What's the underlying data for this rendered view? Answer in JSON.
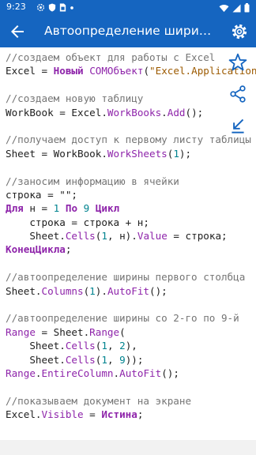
{
  "status_bar": {
    "time": "9:23",
    "left_icons": [
      "gear-icon",
      "shield-icon",
      "sim-icon",
      "dot-icon"
    ],
    "right_icons": [
      "wifi-icon",
      "signal-icon",
      "battery-icon"
    ]
  },
  "app_bar": {
    "title": "Автоопределение ширины ст...",
    "back_icon": "arrow-back-icon",
    "settings_icon": "settings-icon",
    "background": "#1565c0"
  },
  "side_actions": [
    "star-outline-icon",
    "share-icon",
    "download-icon"
  ],
  "code": {
    "colors": {
      "comment": "#757575",
      "keyword": "#8e24aa",
      "number": "#00838f",
      "string": "#9c5a00",
      "text": "#202020"
    },
    "lines": [
      [
        {
          "t": "c",
          "v": "//создаем объект для работы с Excel"
        }
      ],
      [
        {
          "t": "t",
          "v": "Excel = "
        },
        {
          "t": "k",
          "v": "Новый"
        },
        {
          "t": "t",
          "v": " "
        },
        {
          "t": "f",
          "v": "COMОбъект"
        },
        {
          "t": "t",
          "v": "("
        },
        {
          "t": "s",
          "v": "\"Excel.Application\""
        },
        {
          "t": "t",
          "v": ");"
        }
      ],
      [],
      [
        {
          "t": "c",
          "v": "//создаем новую таблицу"
        }
      ],
      [
        {
          "t": "t",
          "v": "WorkBook = Excel."
        },
        {
          "t": "f",
          "v": "WorkBooks"
        },
        {
          "t": "t",
          "v": "."
        },
        {
          "t": "f",
          "v": "Add"
        },
        {
          "t": "t",
          "v": "();"
        }
      ],
      [],
      [
        {
          "t": "c",
          "v": "//получаем доступ к первому листу таблицы"
        }
      ],
      [
        {
          "t": "t",
          "v": "Sheet = WorkBook."
        },
        {
          "t": "f",
          "v": "WorkSheets"
        },
        {
          "t": "t",
          "v": "("
        },
        {
          "t": "n",
          "v": "1"
        },
        {
          "t": "t",
          "v": ");"
        }
      ],
      [],
      [
        {
          "t": "c",
          "v": "//заносим информацию в ячейки"
        }
      ],
      [
        {
          "t": "t",
          "v": "строка = \"\";"
        }
      ],
      [
        {
          "t": "k",
          "v": "Для"
        },
        {
          "t": "t",
          "v": " н = "
        },
        {
          "t": "n",
          "v": "1"
        },
        {
          "t": "t",
          "v": " "
        },
        {
          "t": "k",
          "v": "По"
        },
        {
          "t": "t",
          "v": " "
        },
        {
          "t": "n",
          "v": "9"
        },
        {
          "t": "t",
          "v": " "
        },
        {
          "t": "k",
          "v": "Цикл"
        }
      ],
      [
        {
          "t": "t",
          "v": "    строка = строка + н;"
        }
      ],
      [
        {
          "t": "t",
          "v": "    Sheet."
        },
        {
          "t": "f",
          "v": "Cells"
        },
        {
          "t": "t",
          "v": "("
        },
        {
          "t": "n",
          "v": "1"
        },
        {
          "t": "t",
          "v": ", н)."
        },
        {
          "t": "f",
          "v": "Value"
        },
        {
          "t": "t",
          "v": " = строка;"
        }
      ],
      [
        {
          "t": "k",
          "v": "КонецЦикла"
        },
        {
          "t": "t",
          "v": ";"
        }
      ],
      [],
      [
        {
          "t": "c",
          "v": "//автоопределение ширины первого столбца"
        }
      ],
      [
        {
          "t": "t",
          "v": "Sheet."
        },
        {
          "t": "f",
          "v": "Columns"
        },
        {
          "t": "t",
          "v": "("
        },
        {
          "t": "n",
          "v": "1"
        },
        {
          "t": "t",
          "v": ")."
        },
        {
          "t": "f",
          "v": "AutoFit"
        },
        {
          "t": "t",
          "v": "();"
        }
      ],
      [],
      [
        {
          "t": "c",
          "v": "//автоопределение ширины со 2-го по 9-й"
        }
      ],
      [
        {
          "t": "f",
          "v": "Range"
        },
        {
          "t": "t",
          "v": " = Sheet."
        },
        {
          "t": "f",
          "v": "Range"
        },
        {
          "t": "t",
          "v": "("
        }
      ],
      [
        {
          "t": "t",
          "v": "    Sheet."
        },
        {
          "t": "f",
          "v": "Cells"
        },
        {
          "t": "t",
          "v": "("
        },
        {
          "t": "n",
          "v": "1"
        },
        {
          "t": "t",
          "v": ", "
        },
        {
          "t": "n",
          "v": "2"
        },
        {
          "t": "t",
          "v": "),"
        }
      ],
      [
        {
          "t": "t",
          "v": "    Sheet."
        },
        {
          "t": "f",
          "v": "Cells"
        },
        {
          "t": "t",
          "v": "("
        },
        {
          "t": "n",
          "v": "1"
        },
        {
          "t": "t",
          "v": ", "
        },
        {
          "t": "n",
          "v": "9"
        },
        {
          "t": "t",
          "v": "));"
        }
      ],
      [
        {
          "t": "f",
          "v": "Range"
        },
        {
          "t": "t",
          "v": "."
        },
        {
          "t": "f",
          "v": "EntireColumn"
        },
        {
          "t": "t",
          "v": "."
        },
        {
          "t": "f",
          "v": "AutoFit"
        },
        {
          "t": "t",
          "v": "();"
        }
      ],
      [],
      [
        {
          "t": "c",
          "v": "//показываем документ на экране"
        }
      ],
      [
        {
          "t": "t",
          "v": "Excel."
        },
        {
          "t": "f",
          "v": "Visible"
        },
        {
          "t": "t",
          "v": " = "
        },
        {
          "t": "k",
          "v": "Истина"
        },
        {
          "t": "t",
          "v": ";"
        }
      ]
    ]
  }
}
